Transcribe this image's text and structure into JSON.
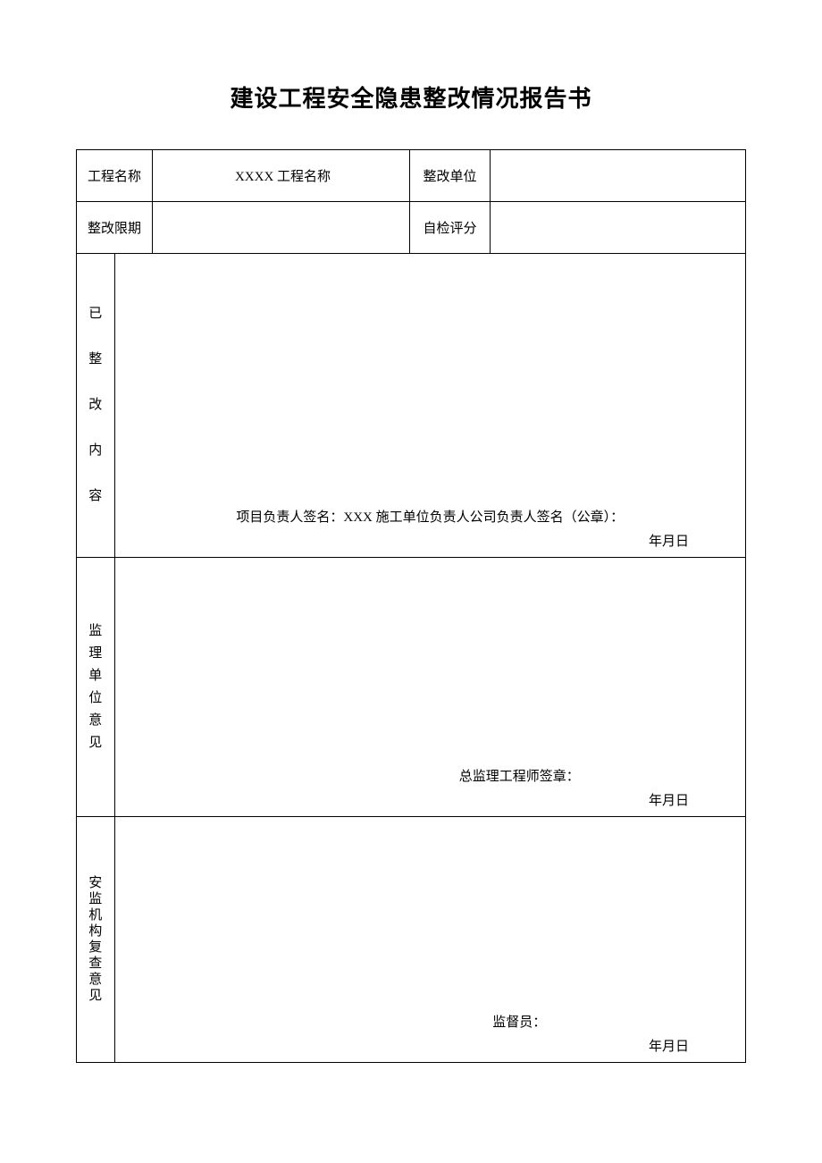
{
  "title": "建设工程安全隐患整改情况报告书",
  "labels": {
    "project_name": "工程名称",
    "rectify_unit": "整改单位",
    "deadline": "整改限期",
    "self_score": "自检评分"
  },
  "values": {
    "project_name": "XXXX 工程名称",
    "rectify_unit": "",
    "deadline": "",
    "self_score": ""
  },
  "sections": {
    "rectified": {
      "label_chars": [
        "已",
        "整",
        "改",
        "内",
        "容"
      ],
      "signature_line": "项目负责人签名：XXX 施工单位负责人公司负责人签名（公章）：",
      "date": "年月日"
    },
    "supervision": {
      "label_chars": [
        "监",
        "理",
        "单",
        "位",
        "意",
        "见"
      ],
      "signature_line": "总监理工程师签章：",
      "date": "年月日"
    },
    "safety_review": {
      "label_chars": [
        "安",
        "监",
        "机",
        "构",
        "复",
        "查",
        "意",
        "见"
      ],
      "signature_line": "监督员：",
      "date": "年月日"
    }
  }
}
